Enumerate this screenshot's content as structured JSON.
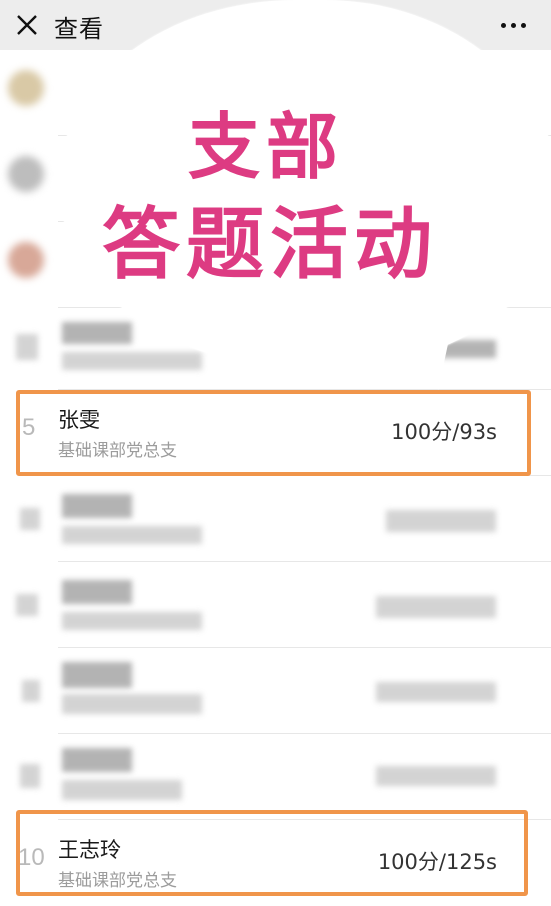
{
  "header": {
    "title": "查看"
  },
  "bubble": {
    "line1": "支部",
    "line2": "答题活动"
  },
  "rows": {
    "zhang": {
      "rank": "5",
      "name": "张雯",
      "dept": "基础课部党总支",
      "score": "100分/93s"
    },
    "wang": {
      "rank": "10",
      "name": "王志玲",
      "dept": "基础课部党总支",
      "score": "100分/125s"
    }
  },
  "colors": {
    "highlight": "#f0954a",
    "bubble_text": "#dd3b82"
  }
}
